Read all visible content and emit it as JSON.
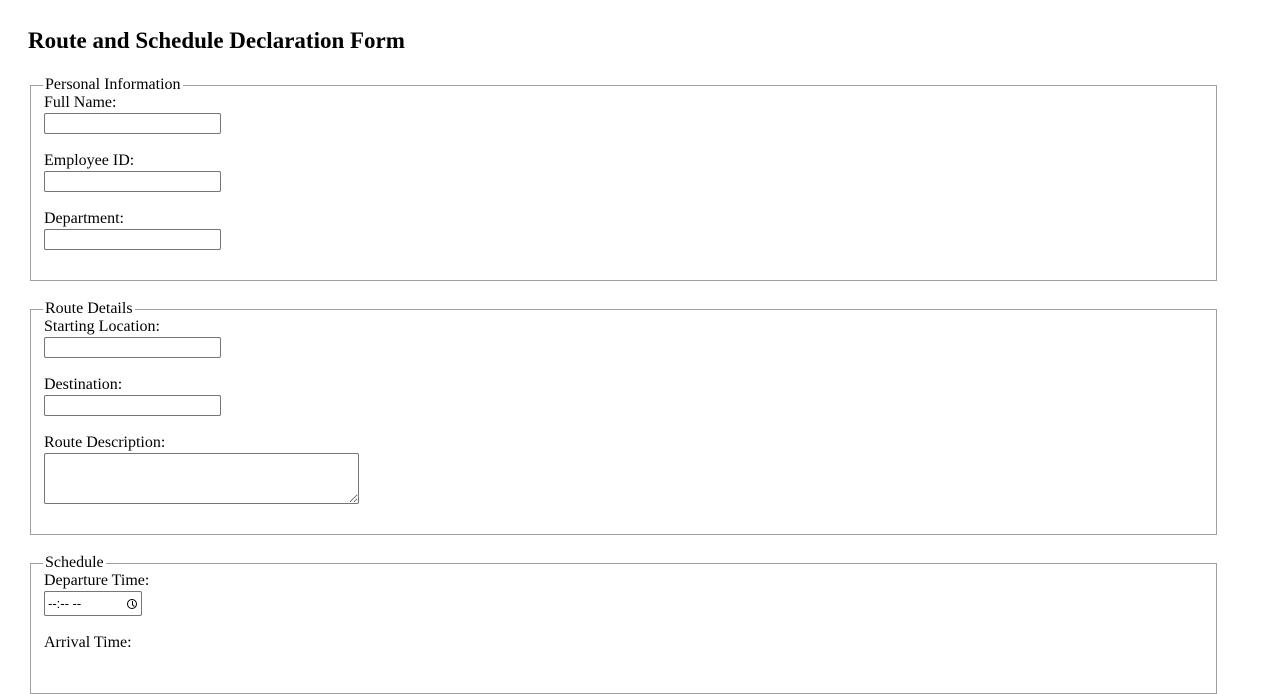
{
  "form": {
    "title": "Route and Schedule Declaration Form",
    "sections": {
      "personal": {
        "legend": "Personal Information",
        "full_name_label": "Full Name:",
        "full_name_value": "",
        "employee_id_label": "Employee ID:",
        "employee_id_value": "",
        "department_label": "Department:",
        "department_value": ""
      },
      "route": {
        "legend": "Route Details",
        "starting_location_label": "Starting Location:",
        "starting_location_value": "",
        "destination_label": "Destination:",
        "destination_value": "",
        "route_description_label": "Route Description:",
        "route_description_value": ""
      },
      "schedule": {
        "legend": "Schedule",
        "departure_time_label": "Departure Time:",
        "departure_time_placeholder": "--:-- --",
        "departure_time_icon": "clock-icon",
        "arrival_time_label": "Arrival Time:"
      }
    }
  }
}
